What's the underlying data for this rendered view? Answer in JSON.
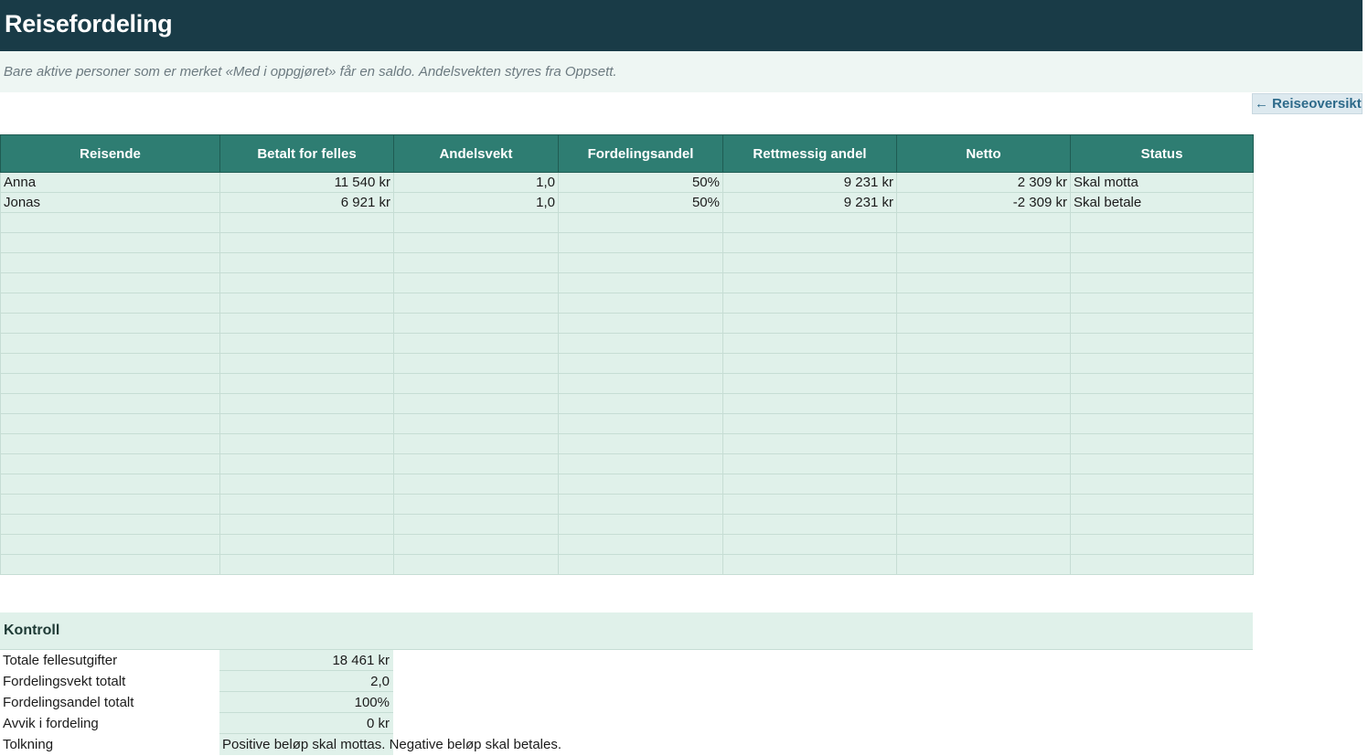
{
  "header": {
    "title": "Reisefordeling",
    "subtitle": "Bare aktive personer som er merket «Med i oppgjøret» får en saldo. Andelsvekten styres fra Oppsett.",
    "nav_link": "← Reiseoversikt"
  },
  "table": {
    "columns": [
      "Reisende",
      "Betalt for felles",
      "Andelsvekt",
      "Fordelingsandel",
      "Rettmessig andel",
      "Netto",
      "Status"
    ],
    "rows": [
      [
        "Anna",
        "11 540 kr",
        "1,0",
        "50%",
        "9 231 kr",
        "2 309 kr",
        "Skal motta"
      ],
      [
        "Jonas",
        "6 921 kr",
        "1,0",
        "50%",
        "9 231 kr",
        "-2 309 kr",
        "Skal betale"
      ]
    ],
    "empty_rows": 18
  },
  "kontroll": {
    "heading": "Kontroll",
    "items": [
      {
        "label": "Totale fellesutgifter",
        "value": "18 461 kr"
      },
      {
        "label": "Fordelingsvekt totalt",
        "value": "2,0"
      },
      {
        "label": "Fordelingsandel totalt",
        "value": "100%"
      },
      {
        "label": "Avvik i fordeling",
        "value": "0 kr"
      },
      {
        "label": "Tolkning",
        "text": "Positive beløp skal mottas. Negative beløp skal betales."
      }
    ]
  },
  "colors": {
    "title_bg": "#193b47",
    "header_bg": "#2e7d72",
    "cell_bg": "#e0f1ea",
    "subtitle_bg": "#eef6f3"
  }
}
